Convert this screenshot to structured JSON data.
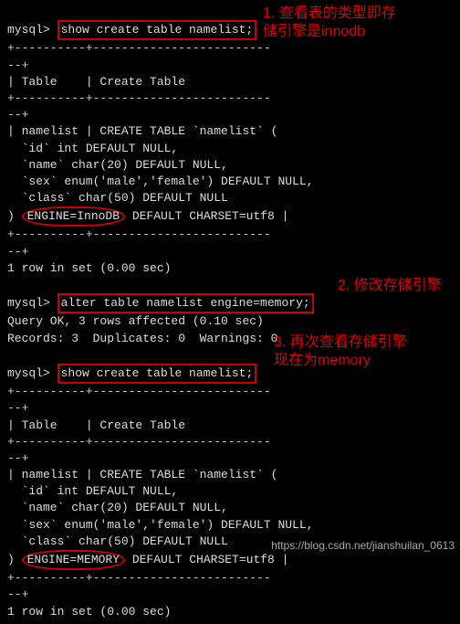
{
  "prompt": "mysql>",
  "cmd1": "show create table namelist;",
  "cmd2": "alter table namelist engine=memory;",
  "cmd3": "show create table namelist;",
  "sep_top": "+----------+-------------------------",
  "sep_bot": "--+",
  "header_table": "| Table    | Create Table",
  "engine1": "ENGINE=InnoDB",
  "engine2": "ENGINE=MEMORY",
  "create1": {
    "l1": "| namelist | CREATE TABLE `namelist` (",
    "l2": "  `id` int DEFAULT NULL,",
    "l3": "  `name` char(20) DEFAULT NULL,",
    "l4": "  `sex` enum('male','female') DEFAULT NULL,",
    "l5": "  `class` char(50) DEFAULT NULL",
    "tail": " DEFAULT CHARSET=utf8 |"
  },
  "row1": "1 row in set (0.00 sec)",
  "alter_out1": "Query OK, 3 rows affected (0.10 sec)",
  "alter_out2": "Records: 3  Duplicates: 0  Warnings: 0",
  "create2": {
    "l1": "| namelist | CREATE TABLE `namelist` (",
    "l2": "  `id` int DEFAULT NULL,",
    "l3": "  `name` char(20) DEFAULT NULL,",
    "l4": "  `sex` enum('male','female') DEFAULT NULL,",
    "l5": "  `class` char(50) DEFAULT NULL",
    "tail": " DEFAULT CHARSET=utf8 |"
  },
  "ann1": "1. 查看表的类型即存",
  "ann1b": "储引擎是innodb",
  "ann2": "2. 修改存储引擎",
  "ann3": "3. 再次查看存储引擎",
  "ann3b": "现在为memory",
  "watermark": "https://blog.csdn.net/jianshuilan_0613",
  "chart_data": null
}
